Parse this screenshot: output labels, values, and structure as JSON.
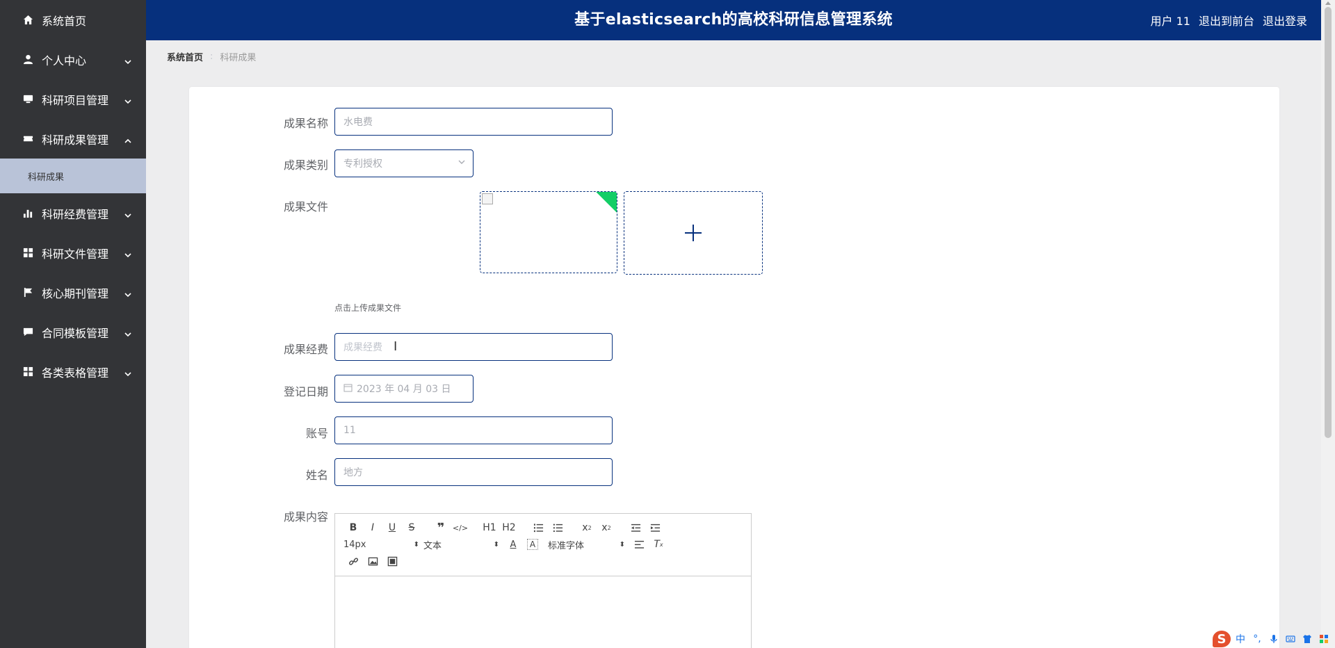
{
  "sidebar": {
    "items": [
      {
        "label": "系统首页",
        "icon": "home-icon"
      },
      {
        "label": "个人中心",
        "icon": "user-icon"
      },
      {
        "label": "科研项目管理",
        "icon": "monitor-icon"
      },
      {
        "label": "科研成果管理",
        "icon": "ticket-icon"
      },
      {
        "label": "科研经费管理",
        "icon": "bar-chart-icon"
      },
      {
        "label": "科研文件管理",
        "icon": "grid-icon"
      },
      {
        "label": "核心期刊管理",
        "icon": "flag-icon"
      },
      {
        "label": "合同模板管理",
        "icon": "chat-icon"
      },
      {
        "label": "各类表格管理",
        "icon": "grid-icon"
      }
    ],
    "sub_item": "科研成果"
  },
  "header": {
    "title": "基于elasticsearch的高校科研信息管理系统",
    "user": "用户 11",
    "to_front": "退出到前台",
    "logout": "退出登录"
  },
  "breadcrumb": {
    "home": "系统首页",
    "separator": ":",
    "current": "科研成果"
  },
  "form": {
    "name_label": "成果名称",
    "name_value": "水电费",
    "category_label": "成果类别",
    "category_value": "专利授权",
    "file_label": "成果文件",
    "upload_hint": "点击上传成果文件",
    "funding_label": "成果经费",
    "funding_placeholder": "成果经费",
    "date_label": "登记日期",
    "date_value": "2023 年 04 月 03 日",
    "account_label": "账号",
    "account_value": "11",
    "name2_label": "姓名",
    "name2_value": "地方",
    "content_label": "成果内容"
  },
  "editor": {
    "font_size": "14px",
    "text_style": "文本",
    "font_family": "标准字体",
    "h1": "H1",
    "h2": "H2"
  },
  "ime": {
    "lang": "中",
    "punct": "°,"
  },
  "colors": {
    "header_bg": "#06307d",
    "sidebar_bg": "#333437",
    "sub_item_bg": "#b9c3d8",
    "upload_done": "#13ce66"
  }
}
